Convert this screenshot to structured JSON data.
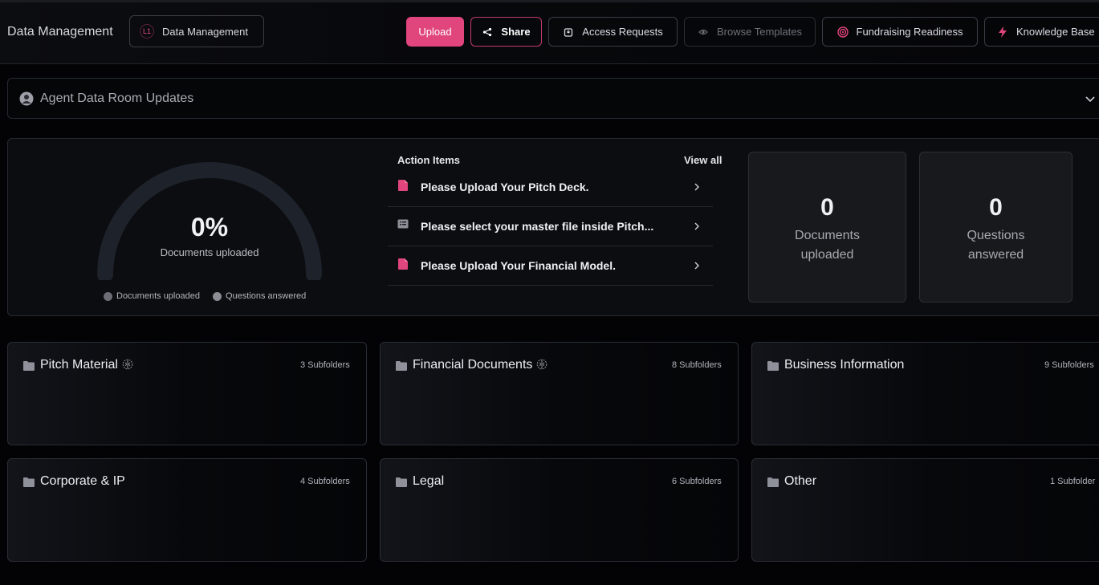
{
  "header": {
    "title": "Data Management",
    "breadcrumb": {
      "badge": "L1",
      "label": "Data Management"
    },
    "buttons": {
      "upload": "Upload",
      "share": "Share",
      "access_requests": "Access Requests",
      "browse_templates": "Browse Templates",
      "fundraising_readiness": "Fundraising Readiness",
      "knowledge_base": "Knowledge Base"
    }
  },
  "accordion": {
    "title": "Agent Data Room Updates"
  },
  "progress": {
    "percent_label": "0%",
    "percent_value": 0,
    "sublabel": "Documents uploaded",
    "legend": [
      "Documents uploaded",
      "Questions answered"
    ]
  },
  "action_items": {
    "title": "Action Items",
    "view_all": "View all",
    "items": [
      {
        "text": "Please Upload Your Pitch Deck.",
        "icon": "document-icon"
      },
      {
        "text": "Please select your master file inside Pitch...",
        "icon": "list-icon"
      },
      {
        "text": "Please Upload Your Financial Model.",
        "icon": "document-icon"
      }
    ]
  },
  "stats": [
    {
      "value": "0",
      "label": "Documents uploaded"
    },
    {
      "value": "0",
      "label": "Questions answered"
    }
  ],
  "folders": [
    {
      "name": "Pitch Material",
      "count": "3 Subfolders",
      "ai": true
    },
    {
      "name": "Financial Documents",
      "count": "8 Subfolders",
      "ai": true
    },
    {
      "name": "Business Information",
      "count": "9 Subfolders",
      "ai": false
    },
    {
      "name": "Corporate & IP",
      "count": "4 Subfolders",
      "ai": false
    },
    {
      "name": "Legal",
      "count": "6 Subfolders",
      "ai": false
    },
    {
      "name": "Other",
      "count": "1 Subfolder",
      "ai": false
    }
  ],
  "colors": {
    "accent": "#e0457b",
    "background": "#030305",
    "gauge_track": "#1e222b",
    "legend_dot": "#6b6e75"
  }
}
